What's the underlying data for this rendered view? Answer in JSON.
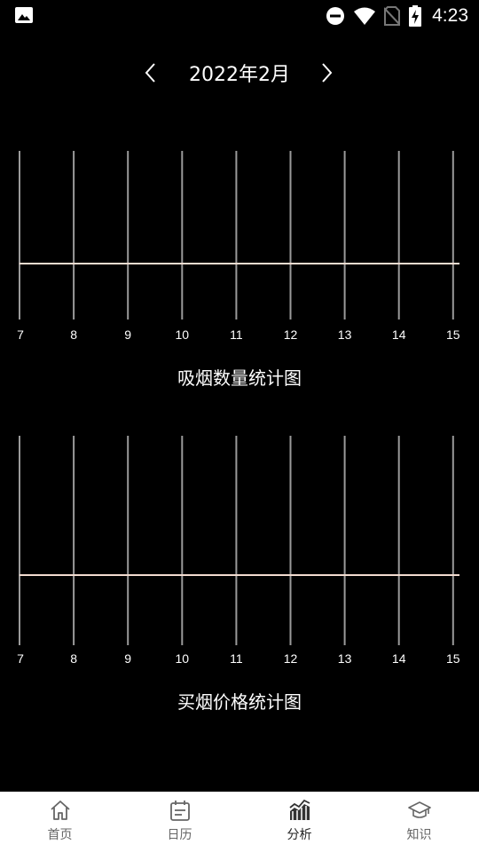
{
  "status_bar": {
    "time": "4:23",
    "icons": [
      "gallery-icon",
      "do-not-disturb-icon",
      "wifi-icon",
      "no-sim-icon",
      "battery-charging-icon"
    ]
  },
  "header": {
    "month": "2022年2月",
    "prev_icon": "chevron-left-icon",
    "next_icon": "chevron-right-icon"
  },
  "chart_data": [
    {
      "type": "line",
      "title": "吸烟数量统计图",
      "x": [
        "7",
        "8",
        "9",
        "10",
        "11",
        "12",
        "13",
        "14",
        "15"
      ],
      "series": [
        {
          "values": [
            0,
            0,
            0,
            0,
            0,
            0,
            0,
            0,
            0
          ]
        }
      ],
      "xlabel": "",
      "ylabel": "",
      "grid": true,
      "colors": {
        "line": "#f3dcd0",
        "grid": "#9a9a9a"
      }
    },
    {
      "type": "line",
      "title": "买烟价格统计图",
      "x": [
        "7",
        "8",
        "9",
        "10",
        "11",
        "12",
        "13",
        "14",
        "15"
      ],
      "series": [
        {
          "values": [
            0,
            0,
            0,
            0,
            0,
            0,
            0,
            0,
            0
          ]
        }
      ],
      "xlabel": "",
      "ylabel": "",
      "grid": true,
      "colors": {
        "line": "#f3dcd0",
        "grid": "#9a9a9a"
      }
    }
  ],
  "bottom_nav": {
    "items": [
      {
        "label": "首页",
        "icon": "home-icon"
      },
      {
        "label": "日历",
        "icon": "calendar-icon"
      },
      {
        "label": "分析",
        "icon": "analysis-chart-icon",
        "active": true
      },
      {
        "label": "知识",
        "icon": "graduation-cap-icon"
      }
    ]
  }
}
